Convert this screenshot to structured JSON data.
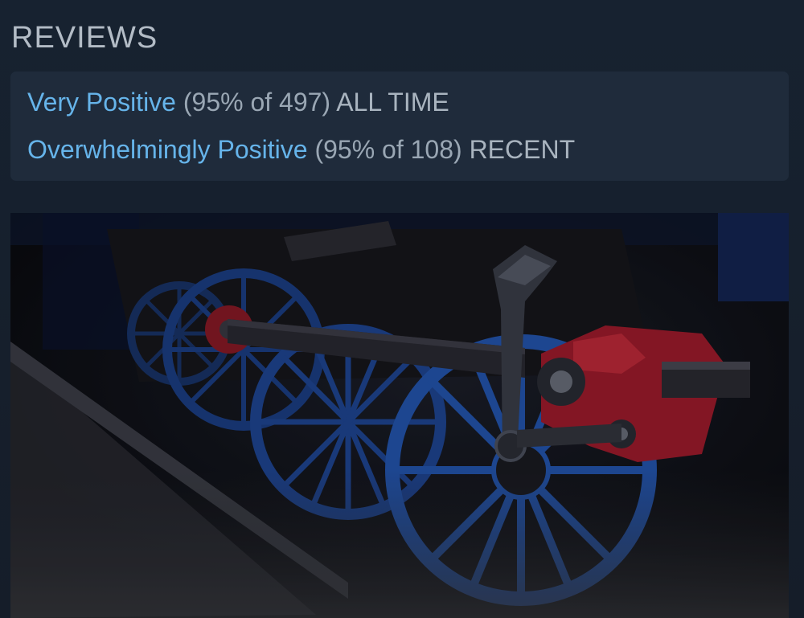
{
  "section": {
    "title": "REVIEWS"
  },
  "reviews": [
    {
      "rating": "Very Positive",
      "detail": "(95% of 497)",
      "period": "ALL TIME"
    },
    {
      "rating": "Overwhelmingly Positive",
      "detail": "(95% of 108)",
      "period": "RECENT"
    }
  ],
  "media": {
    "subject": "pixel-art locomotive wheels and red piston"
  },
  "colors": {
    "rating_link": "#66b4ea",
    "page_background": "#172230",
    "box_background": "#1f2b3b",
    "muted_text": "#9aa7b4"
  }
}
